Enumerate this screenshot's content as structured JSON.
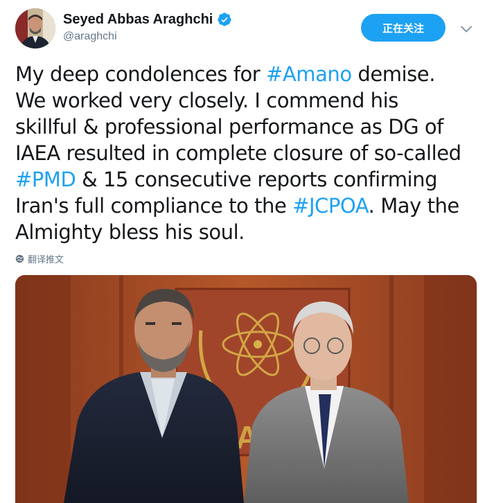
{
  "user": {
    "display_name": "Seyed Abbas Araghchi",
    "handle": "@araghchi",
    "verified_icon": "verified-badge-icon",
    "follow_label": "正在关注",
    "menu_icon": "chevron-down-icon"
  },
  "tweet": {
    "lines": [
      [
        {
          "t": "My deep condolences for "
        },
        {
          "t": "#Amano",
          "h": true
        },
        {
          "t": " demise."
        }
      ],
      [
        {
          "t": "We worked very closely. I commend his"
        }
      ],
      [
        {
          "t": "skillful & professional performance as DG of"
        }
      ],
      [
        {
          "t": "IAEA resulted in complete closure of so-called"
        }
      ],
      [
        {
          "t": "#PMD",
          "h": true
        },
        {
          "t": " & 15 consecutive reports confirming"
        }
      ],
      [
        {
          "t": "Iran's full compliance to the "
        },
        {
          "t": "#JCPOA",
          "h": true
        },
        {
          "t": ". May the"
        }
      ],
      [
        {
          "t": "Almighty bless his soul."
        }
      ]
    ],
    "translate_label": "翻译推文",
    "translate_icon": "globe-icon"
  },
  "colors": {
    "accent": "#1da1f2",
    "text": "#14171a",
    "secondary": "#657786"
  }
}
